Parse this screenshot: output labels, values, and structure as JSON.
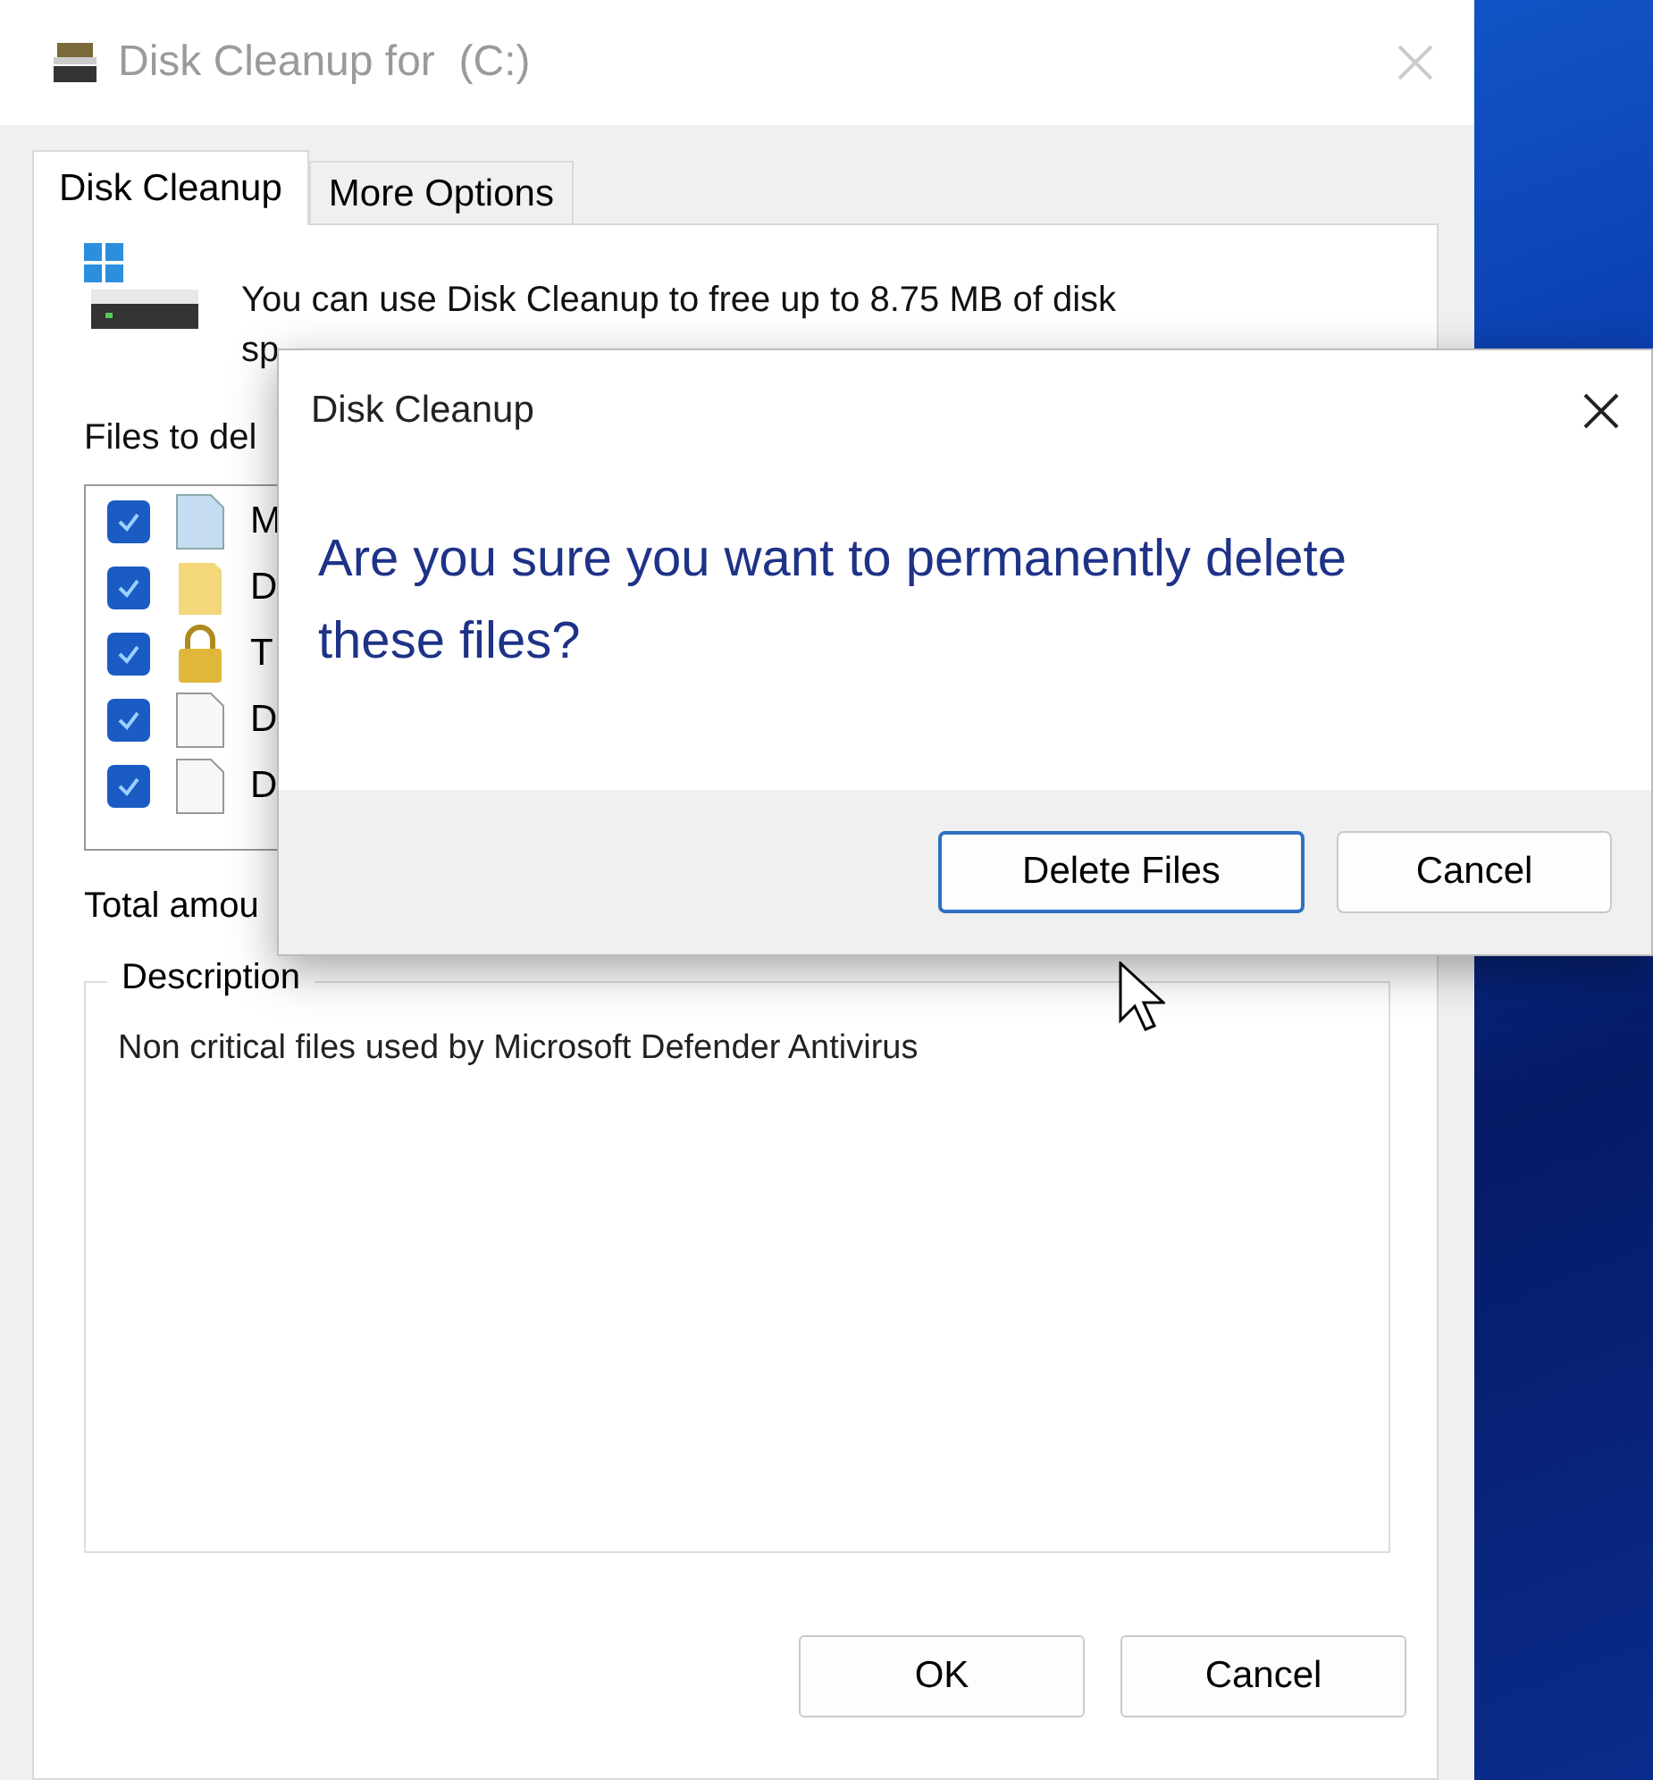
{
  "window": {
    "title": "Disk Cleanup for  (C:)",
    "tabs": [
      {
        "label": "Disk Cleanup",
        "selected": true
      },
      {
        "label": "More Options",
        "selected": false
      }
    ],
    "summary": [
      "You can use Disk Cleanup to free up to 8.75 MB of disk",
      "sp"
    ],
    "files_label": "Files to del",
    "files": [
      {
        "checked": true,
        "kind": "tinted",
        "label": "M"
      },
      {
        "checked": true,
        "kind": "folder",
        "label": "D"
      },
      {
        "checked": true,
        "kind": "locked",
        "label": "T"
      },
      {
        "checked": true,
        "kind": "plain",
        "label": "D"
      },
      {
        "checked": true,
        "kind": "plain",
        "label": "D"
      }
    ],
    "total_label": "Total amou",
    "description": {
      "title": "Description",
      "text": "Non critical files used by Microsoft Defender Antivirus"
    },
    "buttons": [
      "OK",
      "Cancel"
    ]
  },
  "dialog": {
    "title": "Disk Cleanup",
    "message": "Are you sure you want to permanently delete these files?",
    "buttons": [
      {
        "label": "Delete Files",
        "default": true
      },
      {
        "label": "Cancel",
        "default": false
      }
    ]
  }
}
